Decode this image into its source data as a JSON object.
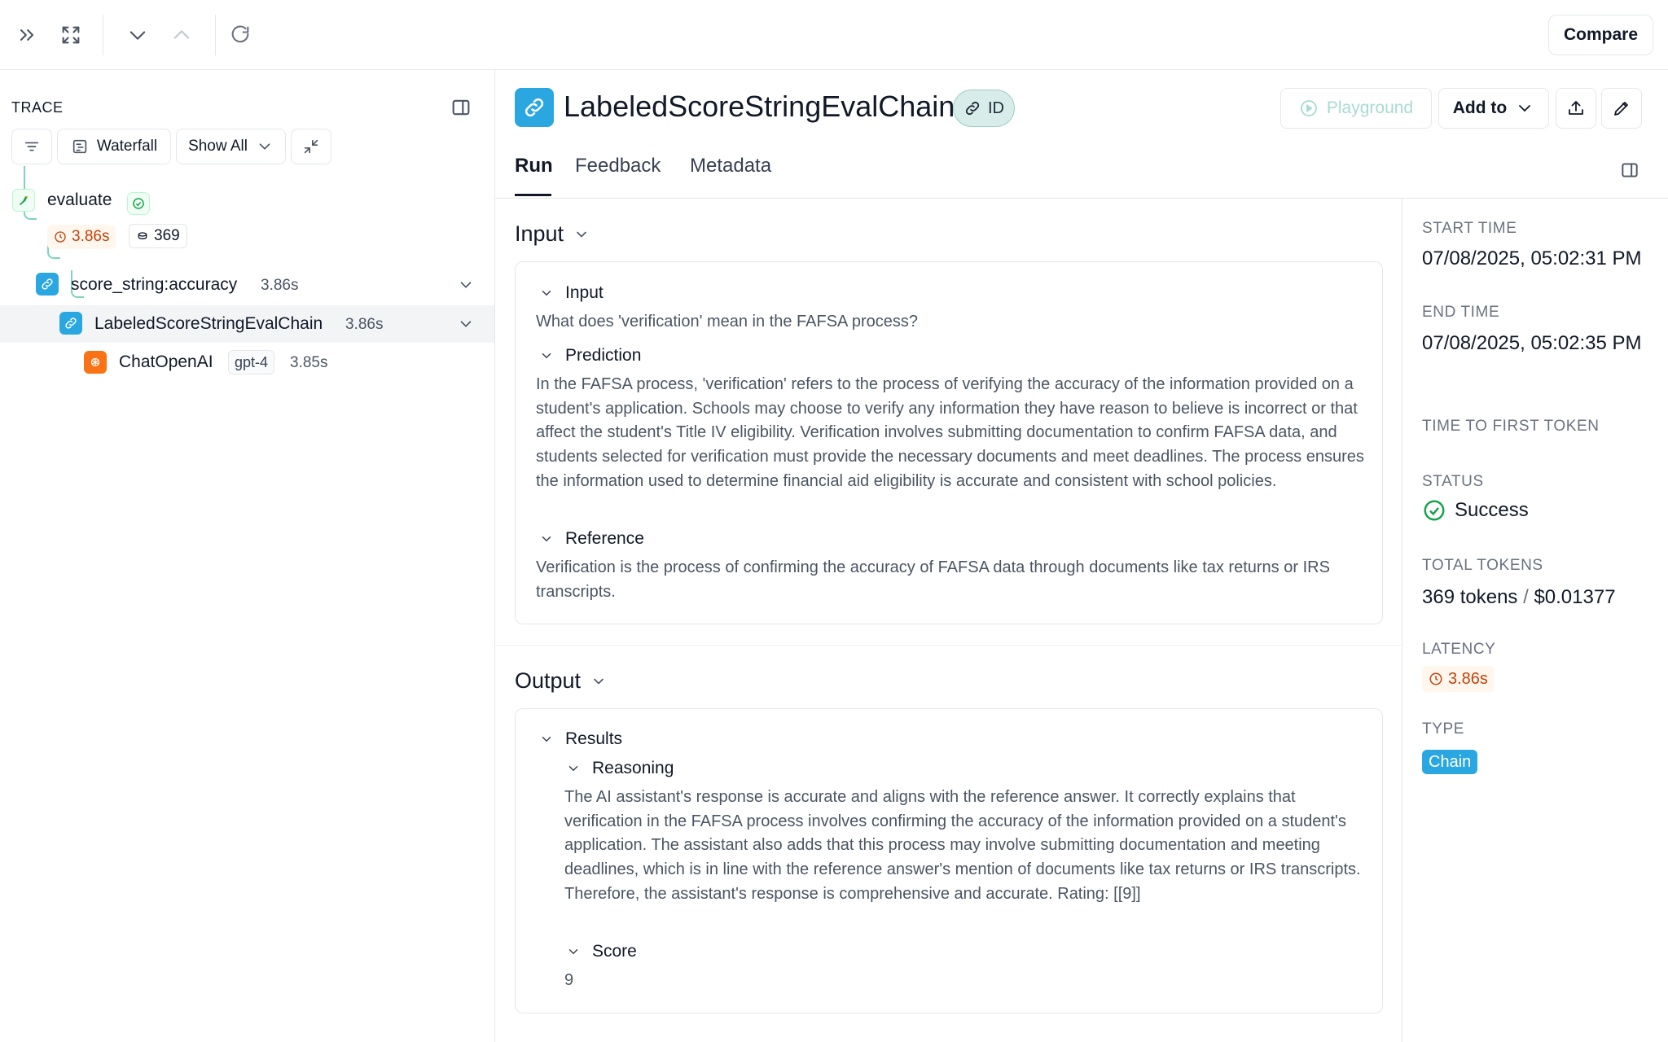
{
  "toolbar": {
    "compare_label": "Compare"
  },
  "trace": {
    "title": "TRACE",
    "waterfall_label": "Waterfall",
    "show_all_label": "Show All",
    "nodes": [
      {
        "label": "evaluate",
        "latency": "3.86s",
        "tokens": "369"
      },
      {
        "label": "score_string:accuracy",
        "latency": "3.86s"
      },
      {
        "label": "LabeledScoreStringEvalChain",
        "latency": "3.86s"
      },
      {
        "label": "ChatOpenAI",
        "model": "gpt-4",
        "latency": "3.85s"
      }
    ]
  },
  "run": {
    "title": "LabeledScoreStringEvalChain",
    "id_label": "ID",
    "playground_label": "Playground",
    "add_to_label": "Add to",
    "tabs": [
      "Run",
      "Feedback",
      "Metadata"
    ]
  },
  "input_section": {
    "title": "Input",
    "fields": [
      {
        "label": "Input",
        "text": "What does 'verification' mean in the FAFSA process?"
      },
      {
        "label": "Prediction",
        "text": "In the FAFSA process, 'verification' refers to the process of verifying the accuracy of the information provided on a student's application. Schools may choose to verify any information they have reason to believe is incorrect or that affect the student's Title IV eligibility. Verification involves submitting documentation to confirm FAFSA data, and students selected for verification must provide the necessary documents and meet deadlines. The process ensures the information used to determine financial aid eligibility is accurate and consistent with school policies."
      },
      {
        "label": "Reference",
        "text": "Verification is the process of confirming the accuracy of FAFSA data through documents like tax returns or IRS transcripts."
      }
    ]
  },
  "output_section": {
    "title": "Output",
    "results_label": "Results",
    "reasoning_label": "Reasoning",
    "reasoning_text": "The AI assistant's response is accurate and aligns with the reference answer. It correctly explains that verification in the FAFSA process involves confirming the accuracy of the information provided on a student's application. The assistant also adds that this process may involve submitting documentation and meeting deadlines, which is in line with the reference answer's mention of documents like tax returns or IRS transcripts. Therefore, the assistant's response is comprehensive and accurate. Rating: [[9]]",
    "score_label": "Score",
    "score_value": "9"
  },
  "meta": {
    "start_time_label": "START TIME",
    "start_time": "07/08/2025, 05:02:31 PM",
    "end_time_label": "END TIME",
    "end_time": "07/08/2025, 05:02:35 PM",
    "ttft_label": "TIME TO FIRST TOKEN",
    "status_label": "STATUS",
    "status": "Success",
    "total_tokens_label": "TOTAL TOKENS",
    "total_tokens": "369 tokens",
    "cost": "$0.01377",
    "latency_label": "LATENCY",
    "latency": "3.86s",
    "type_label": "TYPE",
    "type": "Chain"
  },
  "colors": {
    "accent": "#2aa7e0",
    "success": "#16a34a",
    "latency": "#c2410c",
    "id_pill": "#d8ede9"
  }
}
